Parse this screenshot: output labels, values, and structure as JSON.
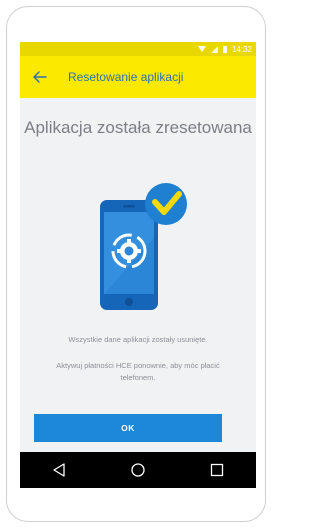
{
  "status_bar": {
    "time": "14:32",
    "icons": [
      "wifi-icon",
      "signal-icon",
      "battery-icon"
    ]
  },
  "app_bar": {
    "back_icon": "arrow-left-icon",
    "title": "Resetowanie aplikacji"
  },
  "main": {
    "headline": "Aplikacja została zresetowana",
    "illustration_icons": [
      "phone-icon",
      "gear-sync-icon",
      "checkmark-badge-icon"
    ],
    "message_1": "Wszystkie dane aplikacji zostały usunięte.",
    "message_2": "Aktywuj płatności HCE ponownie, aby móc płacić telefonem.",
    "ok_label": "OK"
  },
  "nav_bar": {
    "buttons": [
      "back-triangle-icon",
      "home-circle-icon",
      "recents-square-icon"
    ]
  },
  "colors": {
    "app_bar": "#fbe900",
    "status_bar": "#e8d800",
    "title_text": "#2f6fb3",
    "button": "#1e88d8",
    "background": "#f1f2f4",
    "badge": "#1f7fd1",
    "check": "#f5d90a"
  }
}
